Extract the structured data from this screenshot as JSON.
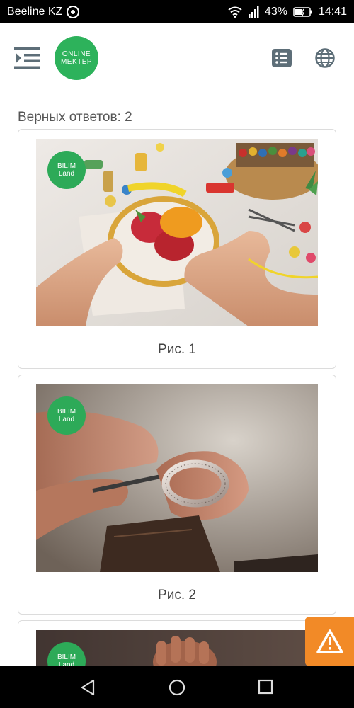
{
  "status_bar": {
    "carrier": "Beeline KZ",
    "battery": "43%",
    "time": "14:41"
  },
  "header": {
    "logo_line1": "ONLINE",
    "logo_line2": "MEKTEP"
  },
  "content": {
    "correct_answers": "Верных ответов: 2",
    "badge_line1": "BILIM",
    "badge_line2": "Land",
    "figures": [
      {
        "caption": "Рис. 1"
      },
      {
        "caption": "Рис. 2"
      }
    ]
  },
  "colors": {
    "brand_green": "#2db25b",
    "warning_orange": "#f28a27",
    "icon_gray": "#5d6e78"
  },
  "icons": {
    "menu": "menu-collapse-icon",
    "list": "list-icon",
    "globe": "globe-icon",
    "warning": "warning-icon",
    "back": "back-triangle-icon",
    "home": "home-circle-icon",
    "recents": "recents-square-icon"
  }
}
